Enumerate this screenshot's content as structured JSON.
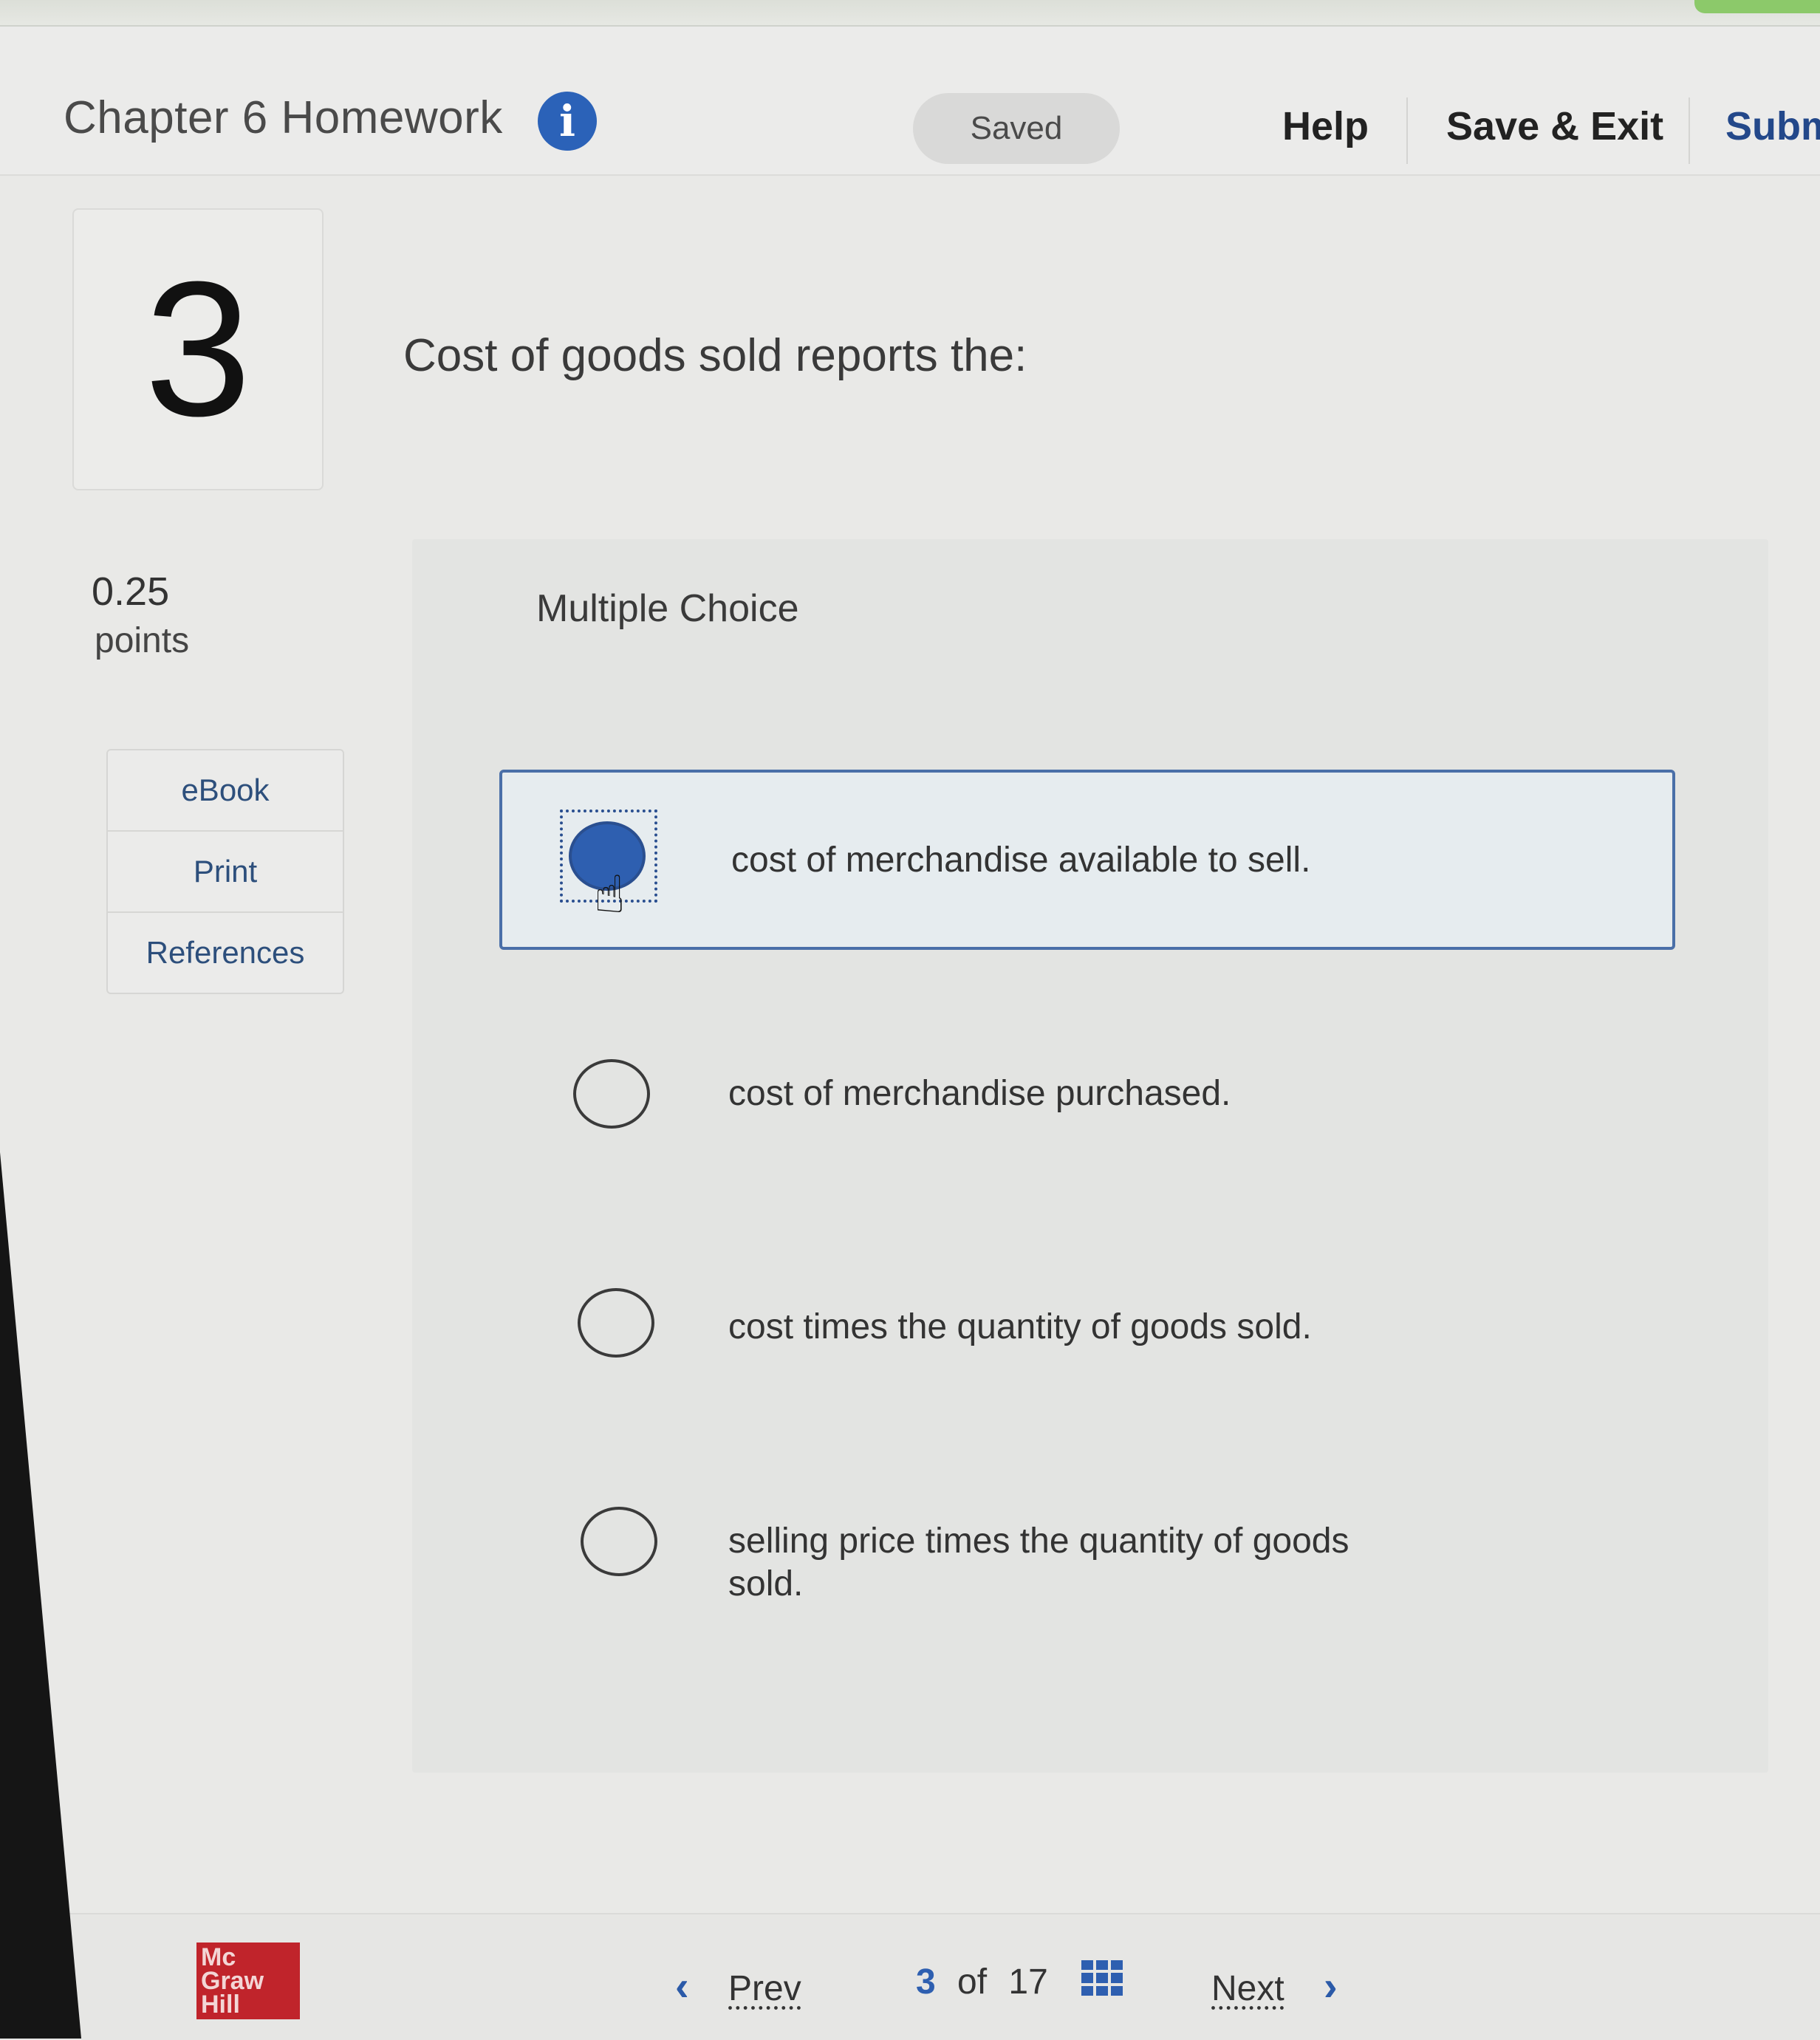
{
  "header": {
    "title": "Chapter 6 Homework",
    "info_icon": "info-icon",
    "status": "Saved",
    "help": "Help",
    "save_exit": "Save & Exit",
    "submit": "Subm"
  },
  "question": {
    "number": "3",
    "text": "Cost of goods sold reports the:",
    "points_value": "0.25",
    "points_label": "points",
    "type_label": "Multiple Choice"
  },
  "tools": [
    {
      "label": "eBook"
    },
    {
      "label": "Print"
    },
    {
      "label": "References"
    }
  ],
  "choices": [
    {
      "text": "cost of merchandise available to sell.",
      "selected": true
    },
    {
      "text": "cost of merchandise purchased.",
      "selected": false
    },
    {
      "text": "cost times the quantity of goods sold.",
      "selected": false
    },
    {
      "text": "selling price times the quantity of goods sold.",
      "selected": false
    }
  ],
  "footer": {
    "logo": "Mc Graw Hill",
    "prev": "Prev",
    "current": "3",
    "of": "of",
    "total": "17",
    "next": "Next"
  },
  "colors": {
    "accent": "#2e5fb0",
    "logo_red": "#c0242b",
    "link_blue": "#2d4f7c"
  }
}
